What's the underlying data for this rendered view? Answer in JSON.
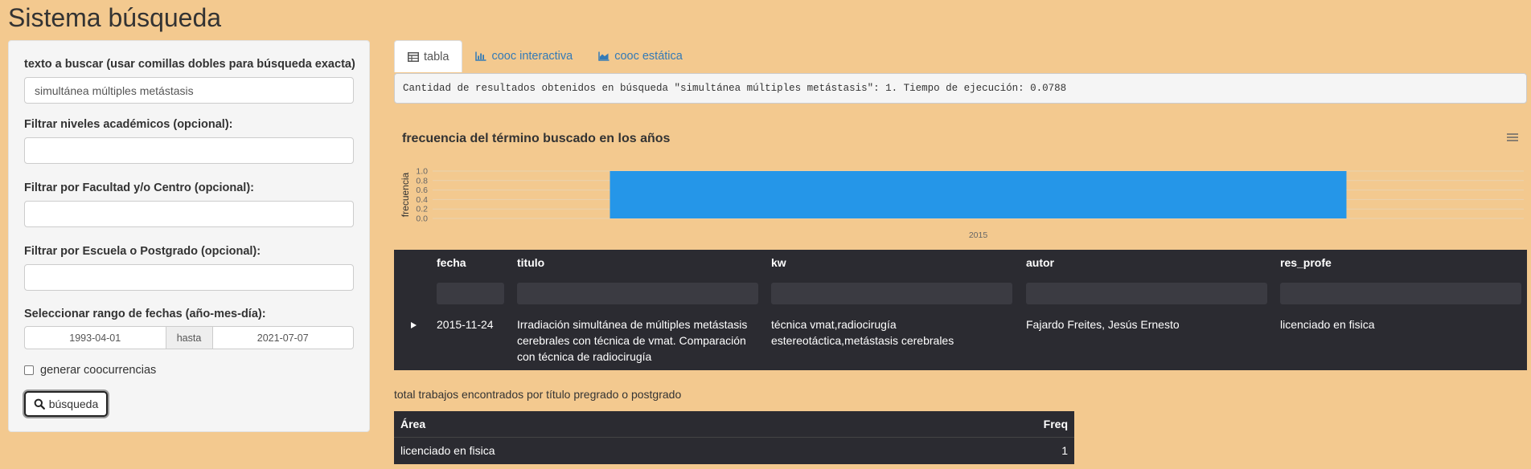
{
  "app": {
    "title": "Sistema búsqueda"
  },
  "sidebar": {
    "search_label": "texto a buscar (usar comillas dobles para búsqueda exacta)",
    "search_value": "simultánea múltiples metástasis",
    "niveles_label": "Filtrar niveles académicos (opcional):",
    "facultad_label": "Filtrar por Facultad y/o Centro (opcional):",
    "escuela_label": "Filtrar por Escuela o Postgrado (opcional):",
    "fechas_label": "Seleccionar rango de fechas (año-mes-día):",
    "fecha_inicio": "1993-04-01",
    "fecha_sep": "hasta",
    "fecha_fin": "2021-07-07",
    "cooc_label": "generar coocurrencias",
    "button_label": "búsqueda"
  },
  "tabs": [
    {
      "label": "tabla",
      "icon": "table-icon",
      "active": true
    },
    {
      "label": "cooc interactiva",
      "icon": "bar-chart-icon",
      "active": false
    },
    {
      "label": "cooc estática",
      "icon": "area-chart-icon",
      "active": false
    }
  ],
  "output": {
    "text": "Cantidad de resultados obtenidos en búsqueda \"simultánea múltiples metástasis\": 1. Tiempo de ejecución: 0.0788"
  },
  "chart": {
    "title": "frecuencia del término buscado en los años"
  },
  "chart_data": {
    "type": "bar",
    "categories": [
      "2015"
    ],
    "values": [
      1.0
    ],
    "title": "frecuencia del término buscado en los años",
    "xlabel": "",
    "ylabel": "frecuencia",
    "yticks": [
      "0.0",
      "0.2",
      "0.4",
      "0.6",
      "0.8",
      "1.0"
    ],
    "ylim": [
      0,
      1.0
    ],
    "bar_color": "#2596e8",
    "grid": true
  },
  "results_table": {
    "columns": [
      "fecha",
      "titulo",
      "kw",
      "autor",
      "res_profe"
    ],
    "rows": [
      {
        "fecha": "2015-11-24",
        "titulo": [
          "Irradiación simultánea de múltiples metástasis",
          "cerebrales con técnica de vmat. Comparación",
          "con técnica de radiocirugía"
        ],
        "kw": [
          "técnica vmat,radiocirugía",
          "estereotáctica,metástasis cerebrales"
        ],
        "autor": "Fajardo Freites, Jesús Ernesto",
        "res_profe": "licenciado en fisica"
      }
    ]
  },
  "freq_table": {
    "caption": "total trabajos encontrados por título pregrado o postgrado",
    "columns": [
      "Área",
      "Freq"
    ],
    "rows": [
      {
        "area": "licenciado en fisica",
        "freq": "1"
      }
    ]
  },
  "colors": {
    "background": "#f3c98f",
    "table_bg": "#2b2b31",
    "link": "#337ab7",
    "bar": "#2596e8"
  }
}
